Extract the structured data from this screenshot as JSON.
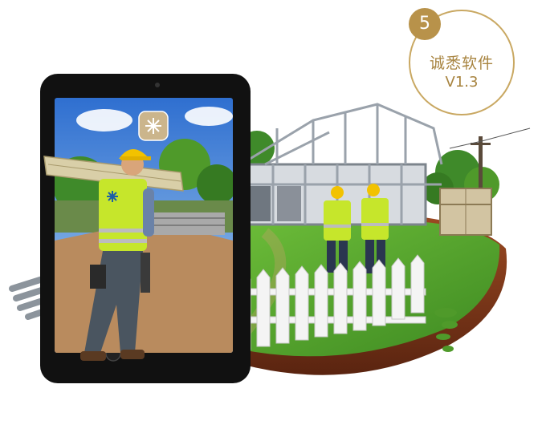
{
  "badge": {
    "number": "5",
    "title": "诚悉软件",
    "version": "V1.3"
  },
  "colors": {
    "gold": "#b8924a",
    "grass": "#4f9a2a",
    "soil": "#8b3a1a",
    "tablet": "#111111",
    "vest": "#c6e62b"
  },
  "icons": [
    "app-logo-icon",
    "vest-logo-icon"
  ]
}
